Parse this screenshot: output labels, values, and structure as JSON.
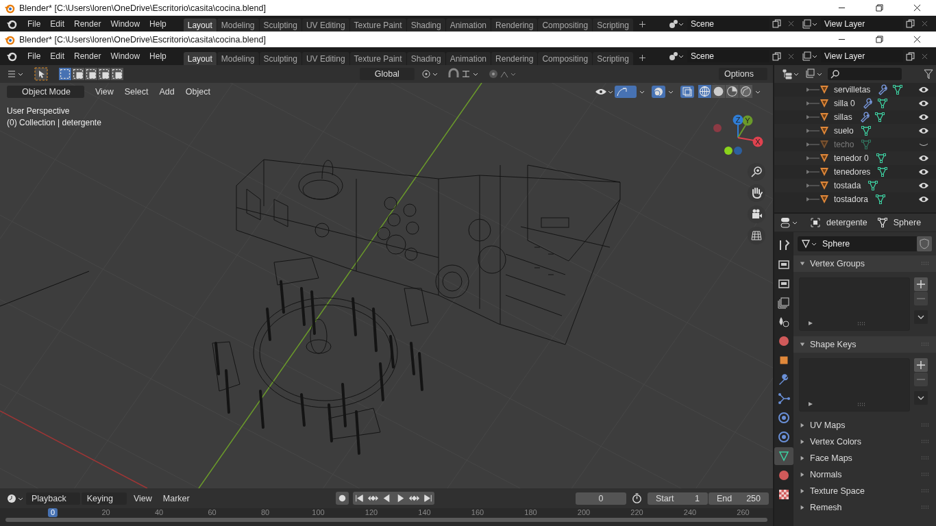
{
  "windows": [
    {
      "title": "Blender* [C:\\Users\\loren\\OneDrive\\Escritorio\\casita\\cocina.blend]",
      "menus": [
        "File",
        "Edit",
        "Render",
        "Window",
        "Help"
      ],
      "workspaces": [
        {
          "label": "Layout",
          "selected": true
        },
        {
          "label": "Modeling",
          "selected": false
        },
        {
          "label": "Sculpting",
          "selected": false
        },
        {
          "label": "UV Editing",
          "selected": false
        },
        {
          "label": "Texture Paint",
          "selected": false
        },
        {
          "label": "Shading",
          "selected": false
        },
        {
          "label": "Animation",
          "selected": false
        },
        {
          "label": "Rendering",
          "selected": false
        },
        {
          "label": "Compositing",
          "selected": false
        },
        {
          "label": "Scripting",
          "selected": false
        }
      ],
      "scene": "Scene",
      "view_layer": "View Layer"
    },
    {
      "title": "Blender* [C:\\Users\\loren\\OneDrive\\Escritorio\\casita\\cocina.blend]",
      "menus": [
        "File",
        "Edit",
        "Render",
        "Window",
        "Help"
      ],
      "workspaces": [
        {
          "label": "Layout",
          "selected": true
        },
        {
          "label": "Modeling",
          "selected": false
        },
        {
          "label": "Sculpting",
          "selected": false
        },
        {
          "label": "UV Editing",
          "selected": false
        },
        {
          "label": "Texture Paint",
          "selected": false
        },
        {
          "label": "Shading",
          "selected": false
        },
        {
          "label": "Animation",
          "selected": false
        },
        {
          "label": "Rendering",
          "selected": false
        },
        {
          "label": "Compositing",
          "selected": false
        },
        {
          "label": "Scripting",
          "selected": false
        }
      ],
      "scene": "Scene",
      "view_layer": "View Layer"
    }
  ],
  "viewport": {
    "transform_orientation": "Global",
    "options": "Options",
    "mode": "Object Mode",
    "menus": [
      "View",
      "Select",
      "Add",
      "Object"
    ],
    "perspective": "User Perspective",
    "collection": "(0) Collection | detergente",
    "axes": [
      "X",
      "Y",
      "Z"
    ],
    "shading": [
      {
        "kind": "wireframe",
        "selected": true
      },
      {
        "kind": "solid",
        "selected": false
      },
      {
        "kind": "material",
        "selected": false
      },
      {
        "kind": "rendered",
        "selected": false
      }
    ]
  },
  "outliner": {
    "items": [
      {
        "name": "servilletas",
        "modifier": true,
        "visible": true
      },
      {
        "name": "silla 0",
        "modifier": true,
        "visible": true
      },
      {
        "name": "sillas",
        "modifier": true,
        "visible": true
      },
      {
        "name": "suelo",
        "modifier": false,
        "visible": true
      },
      {
        "name": "techo",
        "modifier": false,
        "visible": false
      },
      {
        "name": "tenedor 0",
        "modifier": false,
        "visible": true
      },
      {
        "name": "tenedores",
        "modifier": false,
        "visible": true
      },
      {
        "name": "tostada",
        "modifier": false,
        "visible": true
      },
      {
        "name": "tostadora",
        "modifier": false,
        "visible": true
      }
    ]
  },
  "properties": {
    "object": "detergente",
    "data": "Sphere",
    "datablock": "Sphere",
    "tabs": [
      {
        "kind": "tool",
        "selected": false
      },
      {
        "kind": "render",
        "selected": false
      },
      {
        "kind": "output",
        "selected": false
      },
      {
        "kind": "view_layer",
        "selected": false
      },
      {
        "kind": "scene",
        "selected": false
      },
      {
        "kind": "world",
        "selected": false
      },
      {
        "kind": "object",
        "selected": false
      },
      {
        "kind": "modifier",
        "selected": false
      },
      {
        "kind": "particles",
        "selected": false
      },
      {
        "kind": "physics",
        "selected": false
      },
      {
        "kind": "constraints",
        "selected": false
      },
      {
        "kind": "data",
        "selected": true
      },
      {
        "kind": "material",
        "selected": false
      },
      {
        "kind": "texture",
        "selected": false
      }
    ],
    "panels": [
      {
        "title": "Vertex Groups",
        "expanded": true
      },
      {
        "title": "Shape Keys",
        "expanded": true
      },
      {
        "title": "UV Maps",
        "expanded": false
      },
      {
        "title": "Vertex Colors",
        "expanded": false
      },
      {
        "title": "Face Maps",
        "expanded": false
      },
      {
        "title": "Normals",
        "expanded": false
      },
      {
        "title": "Texture Space",
        "expanded": false
      },
      {
        "title": "Remesh",
        "expanded": false
      }
    ]
  },
  "timeline": {
    "menus": [
      {
        "label": "Playback",
        "kind": "dropdown"
      },
      {
        "label": "Keying",
        "kind": "dropdown"
      },
      {
        "label": "View",
        "kind": "menu"
      },
      {
        "label": "Marker",
        "kind": "menu"
      }
    ],
    "current_frame": "0",
    "start_label": "Start",
    "start": "1",
    "end_label": "End",
    "end": "250",
    "ruler": [
      {
        "label": "0",
        "selected": true
      },
      {
        "label": "20",
        "selected": false
      },
      {
        "label": "40",
        "selected": false
      },
      {
        "label": "60",
        "selected": false
      },
      {
        "label": "80",
        "selected": false
      },
      {
        "label": "100",
        "selected": false
      },
      {
        "label": "120",
        "selected": false
      },
      {
        "label": "140",
        "selected": false
      },
      {
        "label": "160",
        "selected": false
      },
      {
        "label": "180",
        "selected": false
      },
      {
        "label": "200",
        "selected": false
      },
      {
        "label": "220",
        "selected": false
      },
      {
        "label": "240",
        "selected": false
      },
      {
        "label": "260",
        "selected": false
      }
    ]
  }
}
